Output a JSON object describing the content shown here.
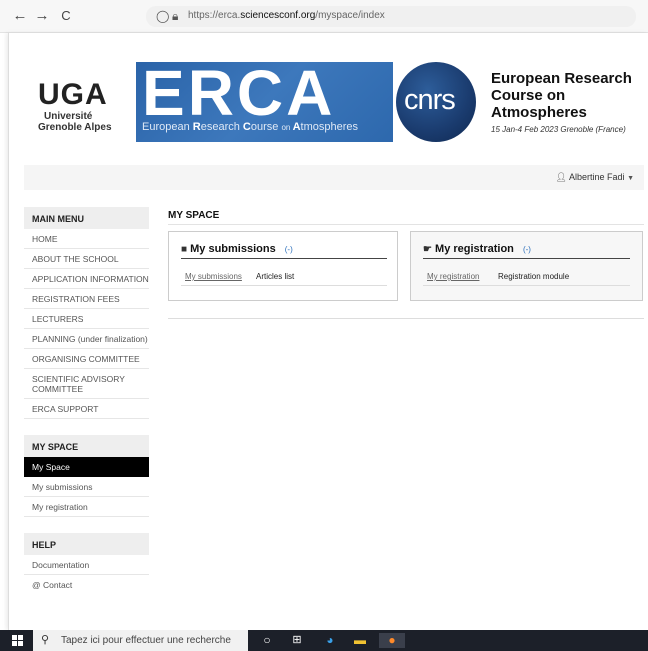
{
  "browser": {
    "back": "←",
    "forward": "→",
    "reload": "C",
    "url_prefix": "https://erca.",
    "url_domain": "sciencesconf.org",
    "url_path": "/myspace/index"
  },
  "header": {
    "uga_word": "UGA",
    "uga_line1": "Université",
    "uga_line2": "Grenoble Alpes",
    "erca_word": "ERCA",
    "erca_tag": [
      "European ",
      "R",
      "esearch ",
      "C",
      "ourse ",
      "on ",
      "A",
      "tmospheres"
    ],
    "cnrs_word": "cnrs",
    "course_title": "European Research Course on Atmospheres",
    "course_dates": "15 Jan-4 Feb 2023 Grenoble (France)"
  },
  "user": {
    "name": "Albertine Fadi"
  },
  "sidebar": {
    "main_menu_title": "MAIN MENU",
    "main_menu": [
      "HOME",
      "ABOUT THE SCHOOL",
      "APPLICATION INFORMATION",
      "REGISTRATION FEES",
      "LECTURERS",
      "PLANNING (under finalization)",
      "ORGANISING COMMITTEE",
      "SCIENTIFIC ADVISORY COMMITTEE",
      "ERCA SUPPORT"
    ],
    "my_space_title": "MY SPACE",
    "my_space": [
      "My Space",
      "My submissions",
      "My registration"
    ],
    "help_title": "HELP",
    "help": [
      "Documentation",
      "@ Contact"
    ]
  },
  "main": {
    "title": "MY SPACE",
    "submissions": {
      "title": "My submissions",
      "toggle": "(-)",
      "link": "My submissions",
      "desc": "Articles list"
    },
    "registration": {
      "title": "My registration",
      "toggle": "(-)",
      "link": "My registration",
      "desc": "Registration module"
    }
  },
  "taskbar": {
    "search_placeholder": "Tapez ici pour effectuer une recherche"
  }
}
